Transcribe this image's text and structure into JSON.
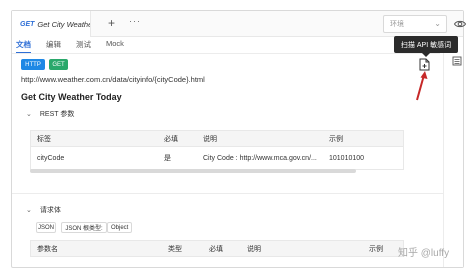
{
  "tab": {
    "method": "GET",
    "title": "Get City Weathe"
  },
  "tabbar": {
    "add": "+",
    "more": "···"
  },
  "env": {
    "placeholder": "环境"
  },
  "subtabs": [
    "文档",
    "编辑",
    "测试",
    "Mock"
  ],
  "tooltip": "扫描 API 敏感词",
  "badges": {
    "http": "HTTP",
    "method": "GET"
  },
  "url": "http://www.weather.com.cn/data/cityinfo/{cityCode}.html",
  "api_title": "Get City Weather Today",
  "rest_section": {
    "title": "REST 参数",
    "headers": [
      "标签",
      "必填",
      "说明",
      "示例"
    ],
    "rows": [
      [
        "cityCode",
        "是",
        "City Code : http://www.mca.gov.cn/...",
        "101010100"
      ]
    ]
  },
  "body_section": {
    "title": "请求体",
    "type_label": "JSON",
    "root_label": "JSON 根类型:",
    "root_value": "Object",
    "headers": [
      "参数名",
      "类型",
      "必填",
      "说明",
      "示例"
    ]
  },
  "watermark": "知乎 @luffy",
  "colors": {
    "accent": "#2f6fd6",
    "http_badge": "#1e88e5",
    "get_badge": "#2aa86b",
    "arrow": "#c62828"
  }
}
